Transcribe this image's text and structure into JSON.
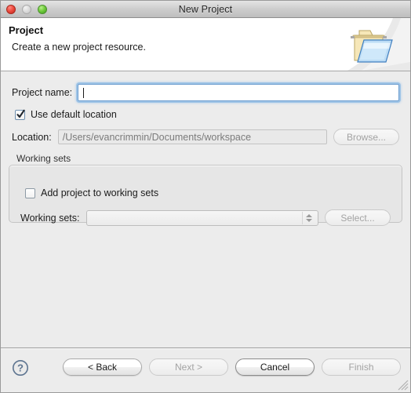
{
  "window": {
    "title": "New Project",
    "controls": {
      "close": "close-button",
      "minimize": "minimize-button",
      "zoom": "zoom-button"
    }
  },
  "banner": {
    "title": "Project",
    "subtitle": "Create a new project resource.",
    "icon": "open-folder-icon"
  },
  "form": {
    "project_name": {
      "label": "Project name:",
      "value": "",
      "placeholder": "",
      "focused": true
    },
    "use_default_location": {
      "label": "Use default location",
      "checked": true
    },
    "location": {
      "label": "Location:",
      "value": "/Users/evancrimmin/Documents/workspace",
      "enabled": false
    },
    "browse_button": {
      "label": "Browse...",
      "enabled": false
    }
  },
  "working_sets": {
    "group_label": "Working sets",
    "add_checkbox": {
      "label": "Add project to working sets",
      "checked": false
    },
    "combo": {
      "label": "Working sets:",
      "value": "",
      "enabled": false
    },
    "select_button": {
      "label": "Select...",
      "enabled": false
    }
  },
  "footer": {
    "help": "help-button",
    "buttons": [
      {
        "label": "< Back",
        "enabled": true,
        "name": "back-button"
      },
      {
        "label": "Next >",
        "enabled": false,
        "name": "next-button"
      },
      {
        "label": "Cancel",
        "enabled": true,
        "name": "cancel-button"
      },
      {
        "label": "Finish",
        "enabled": false,
        "name": "finish-button"
      }
    ],
    "resize_grip": "resize-grip"
  },
  "colors": {
    "window_bg": "#ececec",
    "banner_bg": "#ffffff",
    "focus_ring": "#78afe2",
    "disabled_text": "#a3a3a3"
  }
}
